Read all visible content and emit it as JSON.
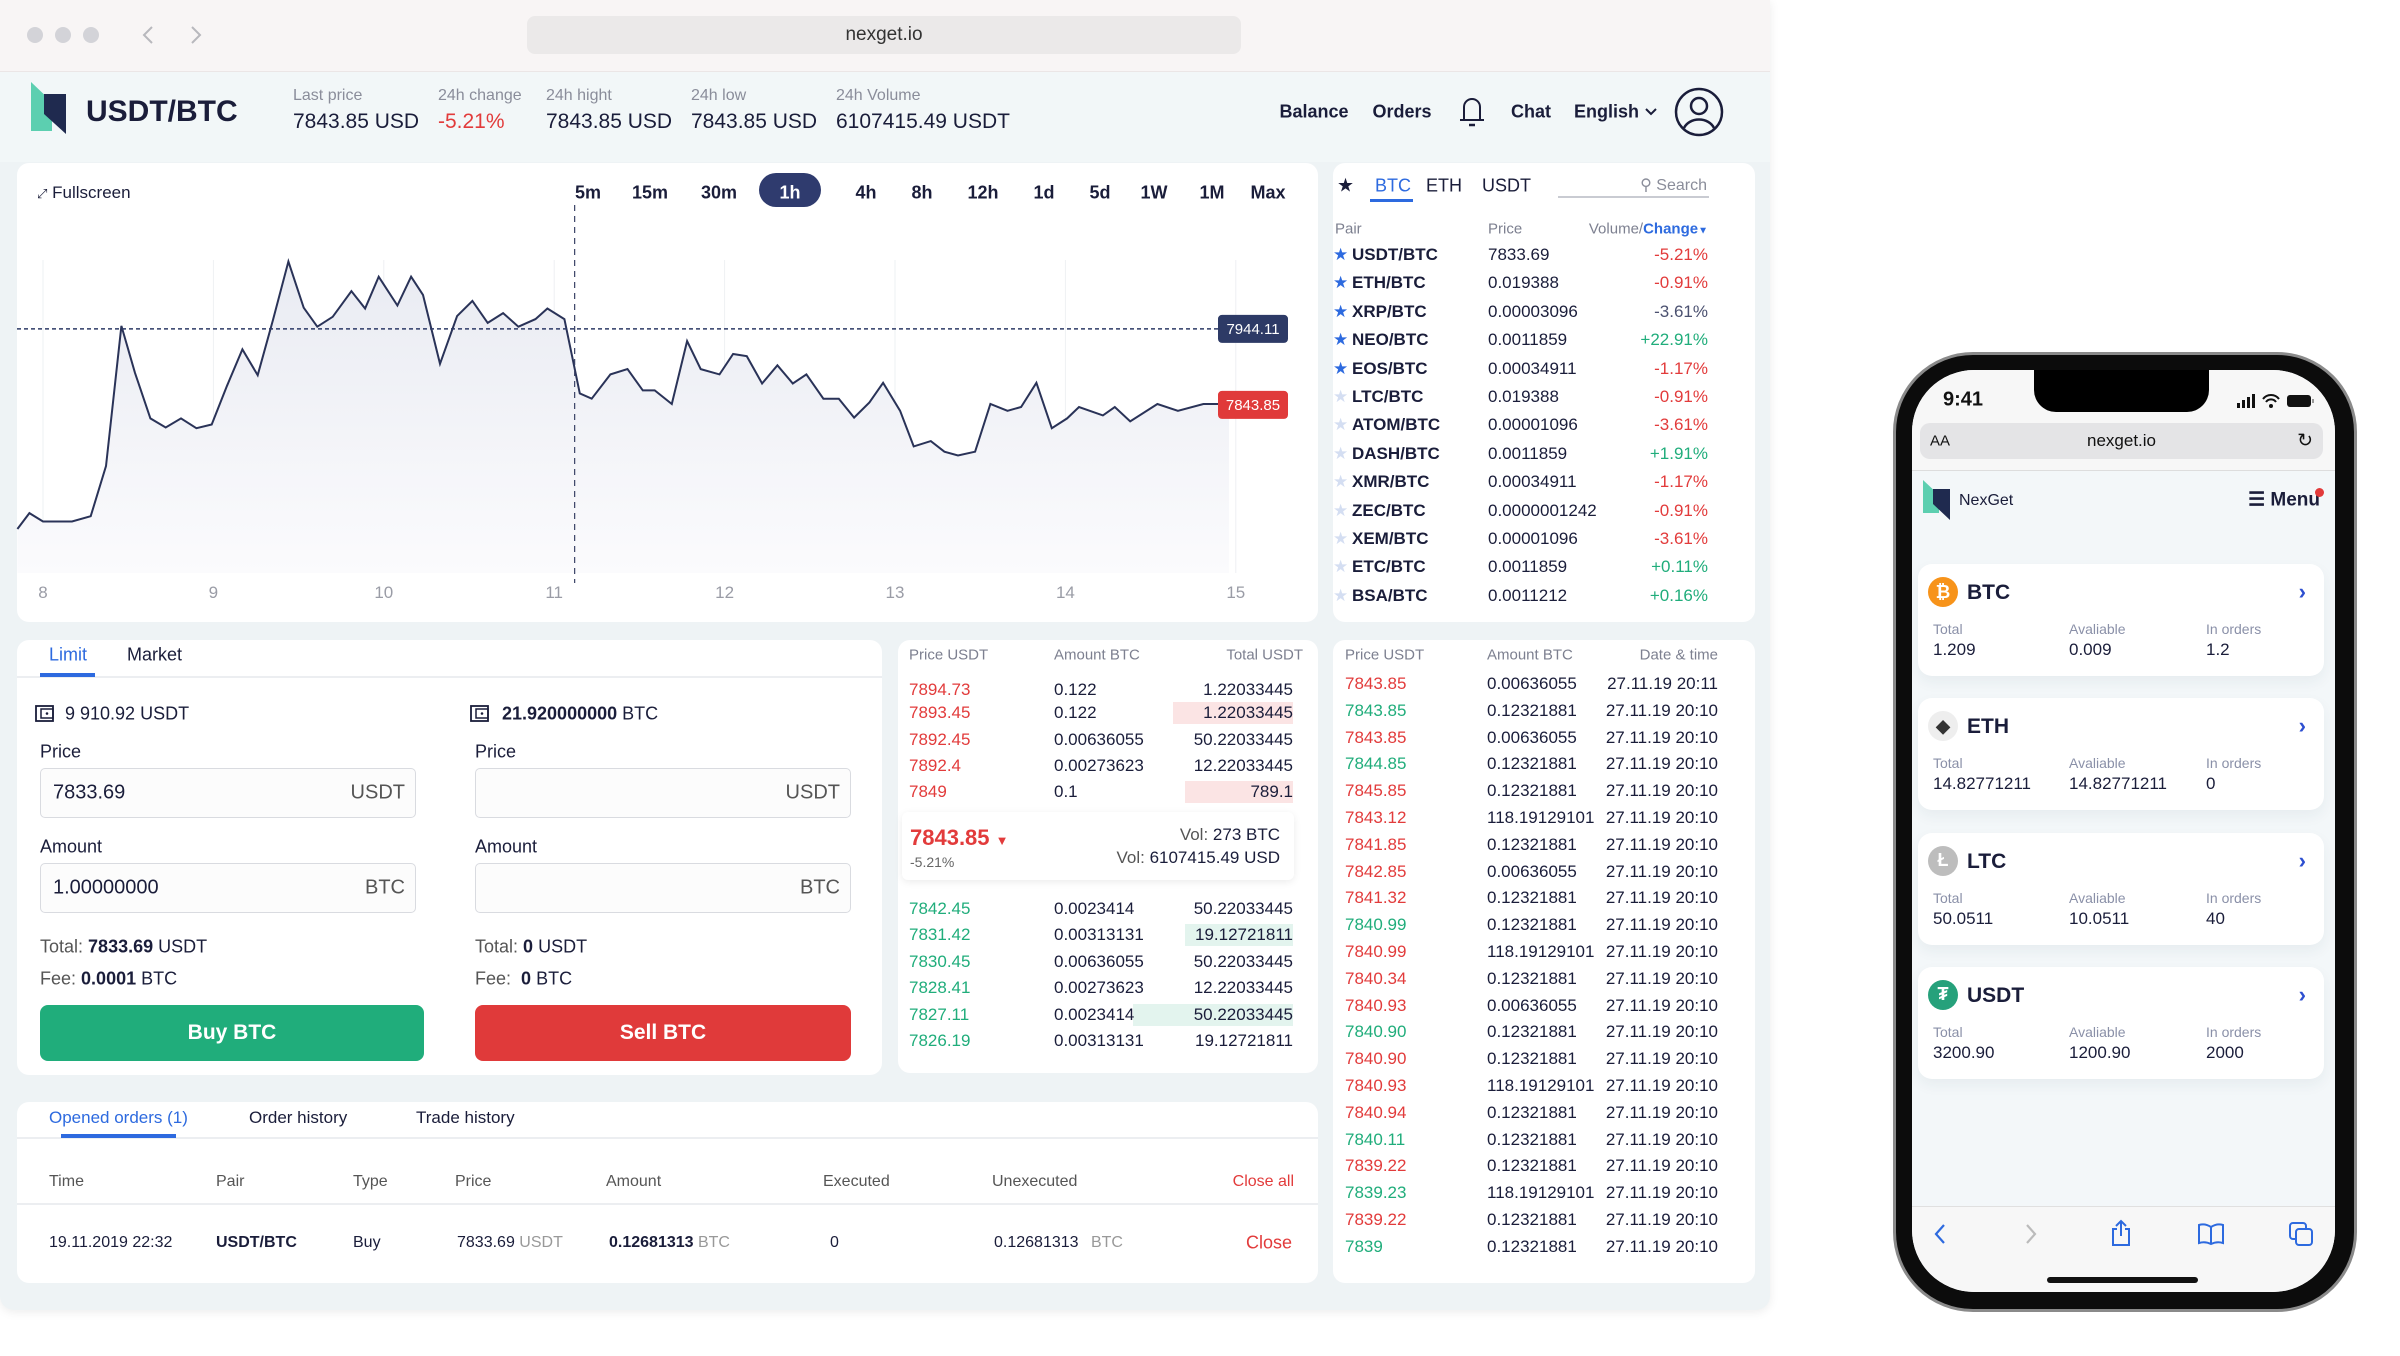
{
  "browser": {
    "url": "nexget.io"
  },
  "header": {
    "pair": "USDT/BTC",
    "stats": [
      {
        "label": "Last price",
        "value": "7843.85 USD",
        "trend": "neutral"
      },
      {
        "label": "24h change",
        "value": "-5.21%",
        "trend": "down"
      },
      {
        "label": "24h hight",
        "value": "7843.85 USD",
        "trend": "neutral"
      },
      {
        "label": "24h low",
        "value": "7843.85 USD",
        "trend": "neutral"
      },
      {
        "label": "24h Volume",
        "value": "6107415.49 USDT",
        "trend": "neutral"
      }
    ],
    "nav": {
      "balance": "Balance",
      "orders": "Orders",
      "chat": "Chat",
      "language": "English"
    },
    "icons": [
      "bell-icon",
      "chevron-down-icon",
      "user-avatar-icon"
    ]
  },
  "chart": {
    "fullscreen_label": "Fullscreen",
    "timeframes": [
      "5m",
      "15m",
      "30m",
      "1h",
      "4h",
      "8h",
      "12h",
      "1d",
      "5d",
      "1W",
      "1M",
      "Max"
    ],
    "active_timeframe": "1h"
  },
  "chart_data": {
    "type": "area",
    "x_ticks": [
      "8",
      "9",
      "10",
      "11",
      "12",
      "13",
      "14",
      "15"
    ],
    "xlim": [
      7.85,
      15
    ],
    "ylim": [
      7622,
      8035
    ],
    "grid": "vertical",
    "line_color": "#2a3358",
    "crosshair_x": 11.12,
    "reference_lines": [
      {
        "value": 7944.11,
        "label": "7944.11",
        "color": "#2d3a66",
        "style": "dashed"
      },
      {
        "value": 7843.85,
        "label": "7843.85",
        "color": "#e03a3a",
        "style": "none"
      }
    ],
    "x": [
      7.85,
      7.92,
      8.0,
      8.17,
      8.28,
      8.37,
      8.46,
      8.54,
      8.63,
      8.72,
      8.81,
      8.9,
      8.99,
      9.08,
      9.17,
      9.26,
      9.35,
      9.44,
      9.53,
      9.61,
      9.7,
      9.81,
      9.89,
      9.97,
      10.08,
      10.16,
      10.23,
      10.33,
      10.43,
      10.52,
      10.61,
      10.7,
      10.79,
      10.89,
      10.96,
      11.06,
      11.15,
      11.22,
      11.33,
      11.43,
      11.52,
      11.59,
      11.69,
      11.78,
      11.86,
      11.97,
      12.05,
      12.13,
      12.22,
      12.31,
      12.4,
      12.48,
      12.58,
      12.67,
      12.76,
      12.85,
      12.93,
      13.03,
      13.11,
      13.21,
      13.29,
      13.37,
      13.47,
      13.56,
      13.66,
      13.74,
      13.83,
      13.92,
      14.01,
      14.08,
      14.22,
      14.29,
      14.38,
      14.54,
      14.66,
      14.81,
      14.96
    ],
    "y": [
      7680,
      7701,
      7690,
      7690,
      7697,
      7763,
      7948,
      7886,
      7826,
      7814,
      7826,
      7813,
      7818,
      7869,
      7917,
      7883,
      7956,
      8033,
      7972,
      7947,
      7960,
      7994,
      7971,
      8013,
      7975,
      8013,
      7989,
      7898,
      7961,
      7981,
      7952,
      7965,
      7947,
      7957,
      7971,
      7957,
      7859,
      7852,
      7884,
      7891,
      7863,
      7863,
      7845,
      7928,
      7891,
      7884,
      7911,
      7908,
      7872,
      7896,
      7872,
      7884,
      7852,
      7852,
      7827,
      7847,
      7873,
      7836,
      7789,
      7796,
      7782,
      7777,
      7782,
      7845,
      7836,
      7841,
      7873,
      7813,
      7826,
      7841,
      7830,
      7841,
      7822,
      7845,
      7836,
      7845,
      7845
    ]
  },
  "pairs": {
    "tabs": [
      "BTC",
      "ETH",
      "USDT"
    ],
    "active_tab": "BTC",
    "search_placeholder": "Search",
    "columns": {
      "pair": "Pair",
      "price": "Price",
      "volume": "Volume/",
      "change": "Change"
    },
    "rows": [
      {
        "pair": "USDT/BTC",
        "price": "7833.69",
        "change": "-5.21%",
        "trend": "down",
        "favorite": true
      },
      {
        "pair": "ETH/BTC",
        "price": "0.019388",
        "change": "-0.91%",
        "trend": "down",
        "favorite": true
      },
      {
        "pair": "XRP/BTC",
        "price": "0.00003096",
        "change": "-3.61%",
        "trend": "neutral",
        "favorite": true
      },
      {
        "pair": "NEO/BTC",
        "price": "0.0011859",
        "change": "+22.91%",
        "trend": "up",
        "favorite": true
      },
      {
        "pair": "EOS/BTC",
        "price": "0.00034911",
        "change": "-1.17%",
        "trend": "down",
        "favorite": true
      },
      {
        "pair": "LTC/BTC",
        "price": "0.019388",
        "change": "-0.91%",
        "trend": "down",
        "favorite": false
      },
      {
        "pair": "ATOM/BTC",
        "price": "0.00001096",
        "change": "-3.61%",
        "trend": "down",
        "favorite": false
      },
      {
        "pair": "DASH/BTC",
        "price": "0.0011859",
        "change": "+1.91%",
        "trend": "up",
        "favorite": false
      },
      {
        "pair": "XMR/BTC",
        "price": "0.00034911",
        "change": "-1.17%",
        "trend": "down",
        "favorite": false
      },
      {
        "pair": "ZEC/BTC",
        "price": "0.0000001242",
        "change": "-0.91%",
        "trend": "down",
        "favorite": false
      },
      {
        "pair": "XEM/BTC",
        "price": "0.00001096",
        "change": "-3.61%",
        "trend": "down",
        "favorite": false
      },
      {
        "pair": "ETC/BTC",
        "price": "0.0011859",
        "change": "+0.11%",
        "trend": "up",
        "favorite": false
      },
      {
        "pair": "BSA/BTC",
        "price": "0.0011212",
        "change": "+0.16%",
        "trend": "up",
        "favorite": false
      }
    ]
  },
  "order_form": {
    "tabs": [
      "Limit",
      "Market"
    ],
    "active_tab": "Limit",
    "buy": {
      "balance": "9 910.92 USDT",
      "price_label": "Price",
      "price_value": "7833.69",
      "price_unit": "USDT",
      "amount_label": "Amount",
      "amount_value": "1.00000000",
      "amount_unit": "BTC",
      "total_label": "Total:",
      "total_value": "7833.69",
      "total_unit": "USDT",
      "fee_label": "Fee:",
      "fee_value": "0.0001",
      "fee_unit": "BTC",
      "button": "Buy BTC",
      "color": "#20ad7b"
    },
    "sell": {
      "balance_value": "21.920000000",
      "balance_unit": "BTC",
      "price_label": "Price",
      "price_value": "",
      "price_unit": "USDT",
      "amount_label": "Amount",
      "amount_value": "",
      "amount_unit": "BTC",
      "total_label": "Total:",
      "total_value": "0",
      "total_unit": "USDT",
      "fee_label": "Fee:",
      "fee_value": "0",
      "fee_unit": "BTC",
      "button": "Sell BTC",
      "color": "#e03a3a"
    }
  },
  "order_book": {
    "columns": [
      "Price USDT",
      "Amount BTC",
      "Total USDT"
    ],
    "asks": [
      {
        "price": "7894.73",
        "amount": "0.122",
        "total": "1.22033445",
        "depth": 0
      },
      {
        "price": "7893.45",
        "amount": "0.122",
        "total": "1.22033445",
        "depth": 0.3
      },
      {
        "price": "7892.45",
        "amount": "0.00636055",
        "total": "50.22033445",
        "depth": 0
      },
      {
        "price": "7892.4",
        "amount": "0.00273623",
        "total": "12.22033445",
        "depth": 0
      },
      {
        "price": "7849",
        "amount": "0.1",
        "total": "789.1",
        "depth": 0.27
      }
    ],
    "last": {
      "price": "7843.85",
      "change": "-5.21%",
      "vol_label": "Vol:",
      "vol_btc": "273 BTC",
      "vol_usd": "6107415.49 USD"
    },
    "bids": [
      {
        "price": "7842.45",
        "amount": "0.0023414",
        "total": "50.22033445",
        "depth": 0
      },
      {
        "price": "7831.42",
        "amount": "0.00313131",
        "total": "19.12721811",
        "depth": 0.27
      },
      {
        "price": "7830.45",
        "amount": "0.00636055",
        "total": "50.22033445",
        "depth": 0
      },
      {
        "price": "7828.41",
        "amount": "0.00273623",
        "total": "12.22033445",
        "depth": 0
      },
      {
        "price": "7827.11",
        "amount": "0.0023414",
        "total": "50.22033445",
        "depth": 0.4
      },
      {
        "price": "7826.19",
        "amount": "0.00313131",
        "total": "19.12721811",
        "depth": 0
      }
    ]
  },
  "trades": {
    "columns": [
      "Price USDT",
      "Amount BTC",
      "Date & time"
    ],
    "rows": [
      {
        "price": "7843.85",
        "side": "sell",
        "amount": "0.00636055",
        "time": "27.11.19 20:11"
      },
      {
        "price": "7843.85",
        "side": "buy",
        "amount": "0.12321881",
        "time": "27.11.19 20:10"
      },
      {
        "price": "7843.85",
        "side": "sell",
        "amount": "0.00636055",
        "time": "27.11.19 20:10"
      },
      {
        "price": "7844.85",
        "side": "buy",
        "amount": "0.12321881",
        "time": "27.11.19 20:10"
      },
      {
        "price": "7845.85",
        "side": "sell",
        "amount": "0.12321881",
        "time": "27.11.19 20:10"
      },
      {
        "price": "7843.12",
        "side": "sell",
        "amount": "118.19129101",
        "time": "27.11.19 20:10"
      },
      {
        "price": "7841.85",
        "side": "sell",
        "amount": "0.12321881",
        "time": "27.11.19 20:10"
      },
      {
        "price": "7842.85",
        "side": "sell",
        "amount": "0.00636055",
        "time": "27.11.19 20:10"
      },
      {
        "price": "7841.32",
        "side": "sell",
        "amount": "0.12321881",
        "time": "27.11.19 20:10"
      },
      {
        "price": "7840.99",
        "side": "buy",
        "amount": "0.12321881",
        "time": "27.11.19 20:10"
      },
      {
        "price": "7840.99",
        "side": "sell",
        "amount": "118.19129101",
        "time": "27.11.19 20:10"
      },
      {
        "price": "7840.34",
        "side": "sell",
        "amount": "0.12321881",
        "time": "27.11.19 20:10"
      },
      {
        "price": "7840.93",
        "side": "sell",
        "amount": "0.00636055",
        "time": "27.11.19 20:10"
      },
      {
        "price": "7840.90",
        "side": "buy",
        "amount": "0.12321881",
        "time": "27.11.19 20:10"
      },
      {
        "price": "7840.90",
        "side": "sell",
        "amount": "0.12321881",
        "time": "27.11.19 20:10"
      },
      {
        "price": "7840.93",
        "side": "sell",
        "amount": "118.19129101",
        "time": "27.11.19 20:10"
      },
      {
        "price": "7840.94",
        "side": "sell",
        "amount": "0.12321881",
        "time": "27.11.19 20:10"
      },
      {
        "price": "7840.11",
        "side": "buy",
        "amount": "0.12321881",
        "time": "27.11.19 20:10"
      },
      {
        "price": "7839.22",
        "side": "sell",
        "amount": "0.12321881",
        "time": "27.11.19 20:10"
      },
      {
        "price": "7839.23",
        "side": "buy",
        "amount": "118.19129101",
        "time": "27.11.19 20:10"
      },
      {
        "price": "7839.22",
        "side": "sell",
        "amount": "0.12321881",
        "time": "27.11.19 20:10"
      },
      {
        "price": "7839",
        "side": "buy",
        "amount": "0.12321881",
        "time": "27.11.19 20:10"
      }
    ]
  },
  "orders": {
    "tabs": [
      "Opened orders (1)",
      "Order history",
      "Trade history"
    ],
    "active_tab": "Opened orders (1)",
    "columns": [
      "Time",
      "Pair",
      "Type",
      "Price",
      "Amount",
      "Executed",
      "Unexecuted"
    ],
    "close_all": "Close all",
    "rows": [
      {
        "time": "19.11.2019 22:32",
        "pair": "USDT/BTC",
        "type": "Buy",
        "price": "7833.69",
        "price_unit": "USDT",
        "amount": "0.12681313",
        "amount_unit": "BTC",
        "executed": "0",
        "unexecuted": "0.12681313",
        "unexecuted_unit": "BTC",
        "action": "Close"
      }
    ]
  },
  "mobile": {
    "time": "9:41",
    "url": "nexget.io",
    "text_size": "AA",
    "brand": "NexGet",
    "menu": "Menu",
    "labels": {
      "total": "Total",
      "available": "Avaliable",
      "in_orders": "In orders"
    },
    "wallets": [
      {
        "coin": "BTC",
        "icon": "bitcoin-icon",
        "color": "#f7931a",
        "total": "1.209",
        "available": "0.009",
        "in_orders": "1.2"
      },
      {
        "coin": "ETH",
        "icon": "ethereum-icon",
        "color": "#eeeeee",
        "total": "14.82771211",
        "available": "14.82771211",
        "in_orders": "0"
      },
      {
        "coin": "LTC",
        "icon": "litecoin-icon",
        "color": "#bdbdbd",
        "total": "50.0511",
        "available": "10.0511",
        "in_orders": "40"
      },
      {
        "coin": "USDT",
        "icon": "tether-icon",
        "color": "#26a17b",
        "total": "3200.90",
        "available": "1200.90",
        "in_orders": "2000"
      }
    ]
  },
  "colors": {
    "accent": "#2d6adf",
    "up": "#20ad7b",
    "down": "#e23b3b",
    "navy": "#2a3358"
  }
}
